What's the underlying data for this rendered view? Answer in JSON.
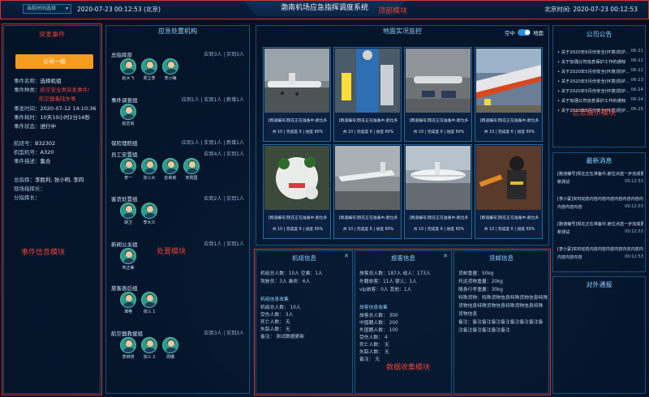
{
  "topbar": {
    "time_select": "当前时间选择",
    "time_left": "2020-07-23 00:12:53 (北京)",
    "title": "渤南机场应急指挥调度系统",
    "time_right": "北京时间: 2020-07-23 00:12:53"
  },
  "annotations": {
    "top": "顶部模块",
    "event": "事件信息模块",
    "org": "处置模块",
    "info_display": "信息展示模块",
    "data_collect": "数据收集模块"
  },
  "event": {
    "title": "突发事件",
    "level_button": "公司一级",
    "fields": [
      {
        "k": "事件名称：",
        "v": "选择机组",
        "red": false
      },
      {
        "k": "事件种类：",
        "v": "航空安全类突发事件/",
        "red": true
      },
      {
        "k": "",
        "v": "航空器着陆失事",
        "red": true
      },
      {
        "k": "事发时间：",
        "v": "2020-07-12 14:10:36",
        "red": false
      },
      {
        "k": "事件耗时：",
        "v": "10天10小时2分16秒",
        "red": false
      },
      {
        "k": "事件状态：",
        "v": "进行中",
        "red": false
      },
      {
        "k": "航班号：",
        "v": "B32302",
        "red": false
      },
      {
        "k": "机型机号：",
        "v": "A320",
        "red": false
      },
      {
        "k": "事件描述：",
        "v": "集合",
        "red": false
      },
      {
        "k": "总指挥：",
        "v": "李胜利, 张小明, 李四",
        "red": false
      },
      {
        "k": "现场指挥长：",
        "v": "",
        "red": false
      },
      {
        "k": "分指挥长：",
        "v": "",
        "red": false
      }
    ]
  },
  "org": {
    "title": "应急处置机构",
    "groups": [
      {
        "name": "总指挥部",
        "stat": "应到3人 | 实到3人",
        "people": [
          "赵大飞",
          "周立李",
          "李小梅"
        ]
      },
      {
        "name": "事件调查组",
        "stat": "应到1人 | 实到1人 | 新增1人",
        "people": [
          "赵志尚"
        ]
      },
      {
        "name": "保险理赔组",
        "stat": "应到1人 | 实到1人 | 新增1人",
        "people": []
      },
      {
        "name": "员工安置组",
        "stat": "应到4人 | 实到1人",
        "people": [
          "李一",
          "张三大",
          "彭莉莉",
          "宋则国"
        ]
      },
      {
        "name": "客货处置组",
        "stat": "应到2人 | 实到1人",
        "people": [
          "胡卫",
          "李大义"
        ]
      },
      {
        "name": "新闻公关组",
        "stat": "应到1人 | 实到1人",
        "people": [
          "朱正美"
        ]
      },
      {
        "name": "旅客善后组",
        "stat": "",
        "people": [
          "谭艳",
          "张三 1"
        ]
      },
      {
        "name": "航空器救援组",
        "stat": "应到3人 | 实到3人",
        "people": [
          "李四饼",
          "张三 2",
          "周珊"
        ]
      }
    ]
  },
  "map": {
    "title": "地面实况监控",
    "toggle_left": "空中",
    "toggle_right": "地面",
    "cards": [
      {
        "cap1": "[跑道编号]现在正在准备中,舱位多",
        "cap2": "共 10 | 完成度 6 | 进度 60%"
      },
      {
        "cap1": "[跑道编号]现在正在准备中,舱位多",
        "cap2": "共 10 | 完成度 6 | 进度 60%"
      },
      {
        "cap1": "[跑道编号]现在正在准备中,舱位多",
        "cap2": "共 10 | 完成度 6 | 进度 60%"
      },
      {
        "cap1": "[跑道编号]现在正在准备中,舱位多",
        "cap2": "共 10 | 完成度 6 | 进度 60%"
      },
      {
        "cap1": "[跑道编号]现在正在准备中,舱位多",
        "cap2": "共 10 | 完成度 6 | 进度 60%"
      },
      {
        "cap1": "[跑道编号]现在正在准备中,舱位多",
        "cap2": "共 10 | 完成度 6 | 进度 60%"
      },
      {
        "cap1": "[跑道编号]现在正在准备中,舱位多",
        "cap2": "共 10 | 完成度 6 | 进度 60%"
      },
      {
        "cap1": "[跑道编号]现在正在准备中,舱位多",
        "cap2": "共 10 | 完成度 6 | 进度 60%"
      }
    ]
  },
  "crew": {
    "title": "机组信息",
    "lines": [
      "机组总人数：10人        空乘：1人",
      "驾驶员：3人               乘务：6人"
    ],
    "sub_title": "机组信息收集",
    "sub_lines": [
      "机组总人数：  10人",
      "受伤人数：  3人",
      "死亡人数：  无",
      "失踪人数：  无",
      "备注：  测试数据更新"
    ]
  },
  "passenger": {
    "title": "旅客信息",
    "lines": [
      "旅客总人数：187人      成人：173人",
      "外籍旅客：11人           婴儿：1人",
      "vip旅客：0人             其他：1人"
    ],
    "sub_title": "旅客信息收集",
    "sub_lines": [
      "旅客总人数：  300",
      "中国籍人数：  200",
      "外国籍人数：  100",
      "受伤人数：  4",
      "死亡人数：  无",
      "失踪人数：  无",
      "备注：  无"
    ]
  },
  "cargo": {
    "title": "货邮信息",
    "lines": [
      "货邮重量：50kg",
      "托运货物重量：20kg",
      "随身行李重量：30kg",
      "特殊货物：特殊货物信息特殊货物信息特殊",
      "货物信息特殊货物信息特殊货物信息特殊",
      "货物信息",
      "备注：备注备注备注备注备注备注备注备",
      "注备注备注备注备注备注"
    ]
  },
  "notice": {
    "title": "公司公告",
    "rows": [
      {
        "t": "• 关于2020年6月份安全(环境)防护...",
        "d": "06-21"
      },
      {
        "t": "• 关于加强公司信息保护工作的通知",
        "d": "06-22"
      },
      {
        "t": "• 关于2020年5月份安全(环境)防护...",
        "d": "06-22"
      },
      {
        "t": "• 关于2020年5月份安全(环境)防护...",
        "d": "06-23"
      },
      {
        "t": "• 关于2020年5月份安全(环境)防护...",
        "d": "06-24"
      },
      {
        "t": "• 关于加强公司信息保护工作的通知",
        "d": "06-24"
      },
      {
        "t": "• 关于2020年5月份安全(环境)防护...",
        "d": "06-25"
      }
    ]
  },
  "news": {
    "title": "最新消息",
    "items": [
      {
        "t": "[跑道编号]现在正在准备中,舱位点选一步完成更",
        "sub": "新测试",
        "time": "00:12:53"
      },
      {
        "t": "[李小蒙]实时动态内容内容内容内容内容内容内容",
        "sub": "内容内容内容",
        "time": "00:12:53"
      },
      {
        "t": "[跑道编号]现在正在准备中,舱位点选一步完成更",
        "sub": "新测试",
        "time": "00:12:53"
      },
      {
        "t": "[李小蒙]实时动态内容内容内容内容内容内容内容",
        "sub": "内容内容内容",
        "time": "00:12:53"
      }
    ]
  },
  "broadcast": {
    "title": "对外通报"
  }
}
